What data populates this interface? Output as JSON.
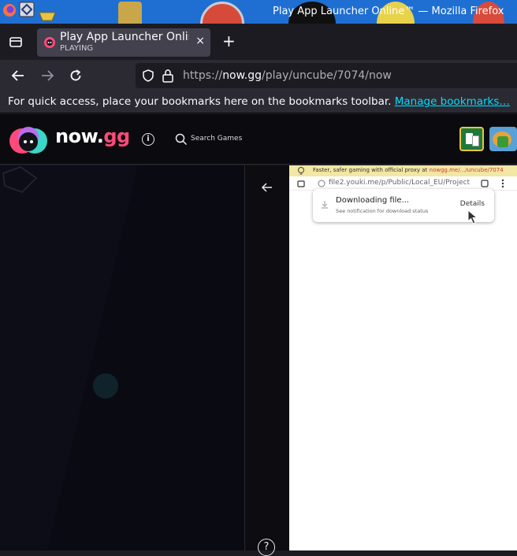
{
  "os": {
    "window_title": "Play App Launcher Online™ — Mozilla Firefox"
  },
  "browser": {
    "tab": {
      "title": "Play App Launcher Online™",
      "status": "PLAYING",
      "close_glyph": "×"
    },
    "new_tab_glyph": "+",
    "url": {
      "prefix": "https://",
      "domain": "now.gg",
      "path": "/play/uncube/7074/now"
    },
    "bookmarks_message": "For quick access, place your bookmarks here on the bookmarks toolbar.",
    "bookmarks_link": "Manage bookmarks…"
  },
  "nowgg": {
    "logo_now": "now.",
    "logo_gg": "gg",
    "info_glyph": "i",
    "search_placeholder": "Search Games"
  },
  "game": {
    "proxy_notice": "Faster, safer gaming with official proxy at",
    "proxy_link": "nowgg.me/.../uncube/7074",
    "mini_url": "file2.youki.me/p/Public/Local_EU/Project",
    "download_title": "Downloading file...",
    "download_subtitle": "See notification for download status",
    "download_action": "Details"
  },
  "sidebar": {
    "help_glyph": "?"
  },
  "colors": {
    "accent_cyan": "#00ddff",
    "brand_pink": "#ff4a7a",
    "os_blue": "#1f6fd2"
  }
}
